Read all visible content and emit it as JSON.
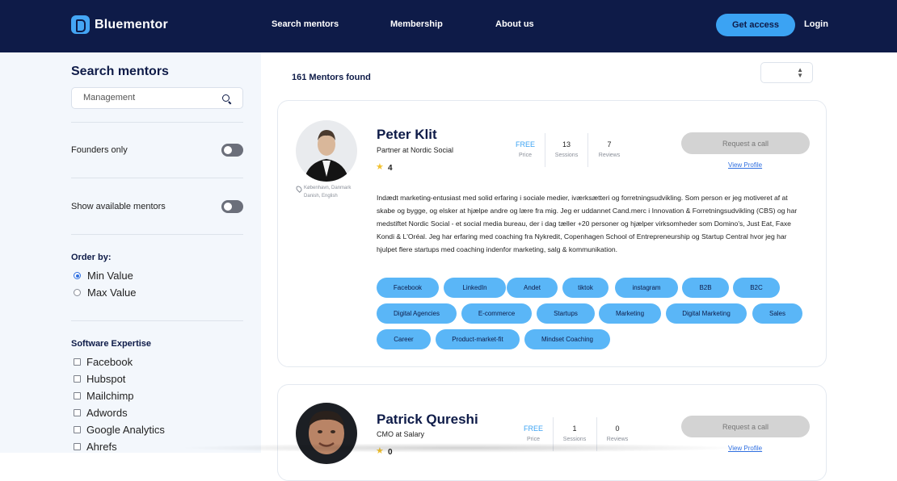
{
  "header": {
    "brand": "Bluementor",
    "nav": [
      "Search mentors",
      "Membership",
      "About us"
    ],
    "cta": "Get access",
    "login": "Login"
  },
  "sidebar": {
    "title": "Search mentors",
    "search_value": "Management",
    "toggles": [
      {
        "label": "Founders only",
        "on": false
      },
      {
        "label": "Show available mentors",
        "on": false
      }
    ],
    "order": {
      "title": "Order by:",
      "options": [
        "Min Value",
        "Max Value"
      ],
      "selected": "Min Value"
    },
    "software": {
      "title": "Software Expertise",
      "items": [
        "Facebook",
        "Hubspot",
        "Mailchimp",
        "Adwords",
        "Google Analytics",
        "Ahrefs"
      ]
    }
  },
  "main": {
    "results_count": "161 Mentors found",
    "mentors": [
      {
        "name": "Peter Klit",
        "role": "Partner at Nordic Social",
        "rating": "4",
        "location": "København, Danmark",
        "languages": "Danish, English",
        "price": "FREE",
        "price_label": "Price",
        "sessions": "13",
        "sessions_label": "Sessions",
        "reviews": "7",
        "reviews_label": "Reviews",
        "request_label": "Request a call",
        "view_profile": "View Profile",
        "bio": "Indædt marketing-entusiast med solid erfaring i sociale medier, iværksætteri og forretningsudvikling. Som person er jeg motiveret af at skabe og bygge, og elsker at hjælpe andre og lære fra mig. Jeg er uddannet Cand.merc i Innovation & Forretningsudvikling (CBS) og har medstiftet Nordic Social - et social media bureau, der i dag tæller +20 personer og hjælper virksomheder som Domino's, Just Eat, Faxe Kondi & L'Oréal. Jeg har erfaring med coaching fra Nykredit, Copenhagen School of Entrepreneurship og Startup Central hvor jeg har hjulpet flere startups med coaching indenfor marketing, salg & kommunikation.",
        "tags": [
          "Facebook",
          "LinkedIn",
          "Andet",
          "tiktok",
          "instagram",
          "B2B",
          "B2C",
          "Digital Agencies",
          "E-commerce",
          "Startups",
          "Marketing",
          "Digital Marketing",
          "Sales",
          "Career",
          "Product-market-fit",
          "Mindset Coaching"
        ]
      },
      {
        "name": "Patrick Qureshi",
        "role": "CMO at Salary",
        "rating": "0",
        "price": "FREE",
        "price_label": "Price",
        "sessions": "1",
        "sessions_label": "Sessions",
        "reviews": "0",
        "reviews_label": "Reviews",
        "request_label": "Request a call",
        "view_profile": "View Profile"
      }
    ]
  },
  "colors": {
    "navy": "#0e1b48",
    "accent": "#3ba3f3",
    "tag": "#5ab6f7",
    "sidebar_bg": "#f3f7fc"
  }
}
